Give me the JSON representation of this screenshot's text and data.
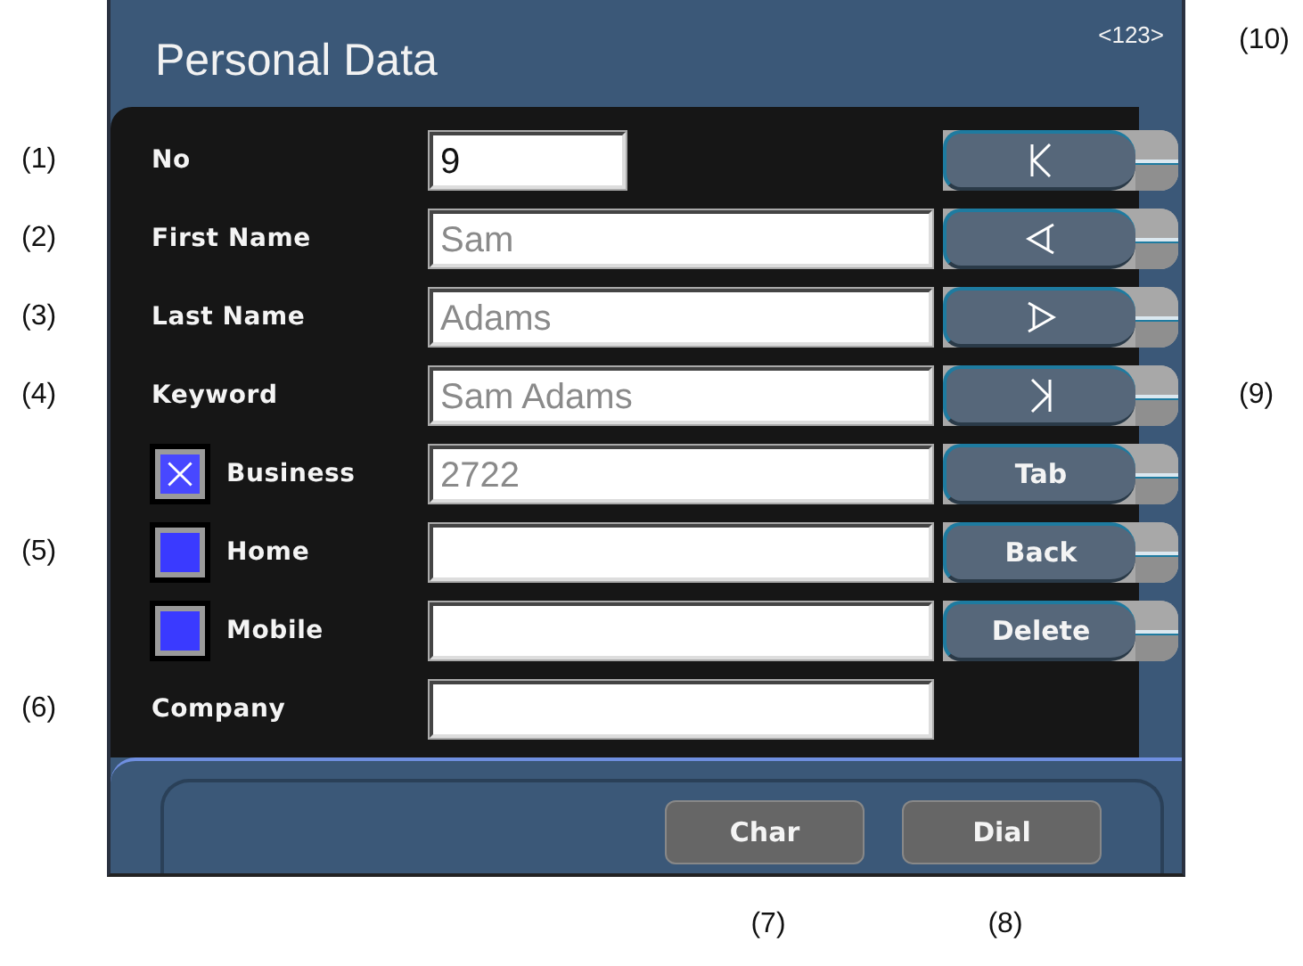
{
  "header": {
    "title": "Personal Data",
    "counter": "<123>",
    "callout": "(10)"
  },
  "rows": [
    {
      "label": "No",
      "callout": "(1)",
      "field": {
        "value": "9",
        "kind": "short",
        "disabled": false
      }
    },
    {
      "label": "First Name",
      "callout": "(2)",
      "field": {
        "value": "Sam",
        "kind": "wide",
        "disabled": true
      }
    },
    {
      "label": "Last Name",
      "callout": "(3)",
      "field": {
        "value": "Adams",
        "kind": "wide",
        "disabled": true
      }
    },
    {
      "label": "Keyword",
      "callout": "(4)",
      "field": {
        "value": "Sam Adams",
        "kind": "wide",
        "disabled": true
      }
    },
    {
      "label": "Business",
      "checkbox": {
        "checked": true
      },
      "field": {
        "value": "2722",
        "kind": "wide",
        "disabled": true
      }
    },
    {
      "label": "Home",
      "callout": "(5)",
      "checkbox": {
        "checked": false
      },
      "field": {
        "kind": "wide"
      }
    },
    {
      "label": "Mobile",
      "checkbox": {
        "checked": false
      },
      "field": {
        "kind": "wide"
      }
    },
    {
      "label": "Company",
      "callout": "(6)",
      "field": {
        "kind": "wide"
      }
    }
  ],
  "buttons": [
    {
      "kind": "icon"
    },
    {
      "kind": "icon"
    },
    {
      "kind": "icon"
    },
    {
      "kind": "icon",
      "callout": "(9)"
    },
    {
      "kind": "text",
      "label": "Tab"
    },
    {
      "kind": "text",
      "label": "Back"
    },
    {
      "kind": "text",
      "label": "Delete"
    }
  ],
  "footer_buttons": [
    {
      "label": "Char",
      "callout": "(7)"
    },
    {
      "label": "Dial",
      "callout": "(8)"
    }
  ]
}
